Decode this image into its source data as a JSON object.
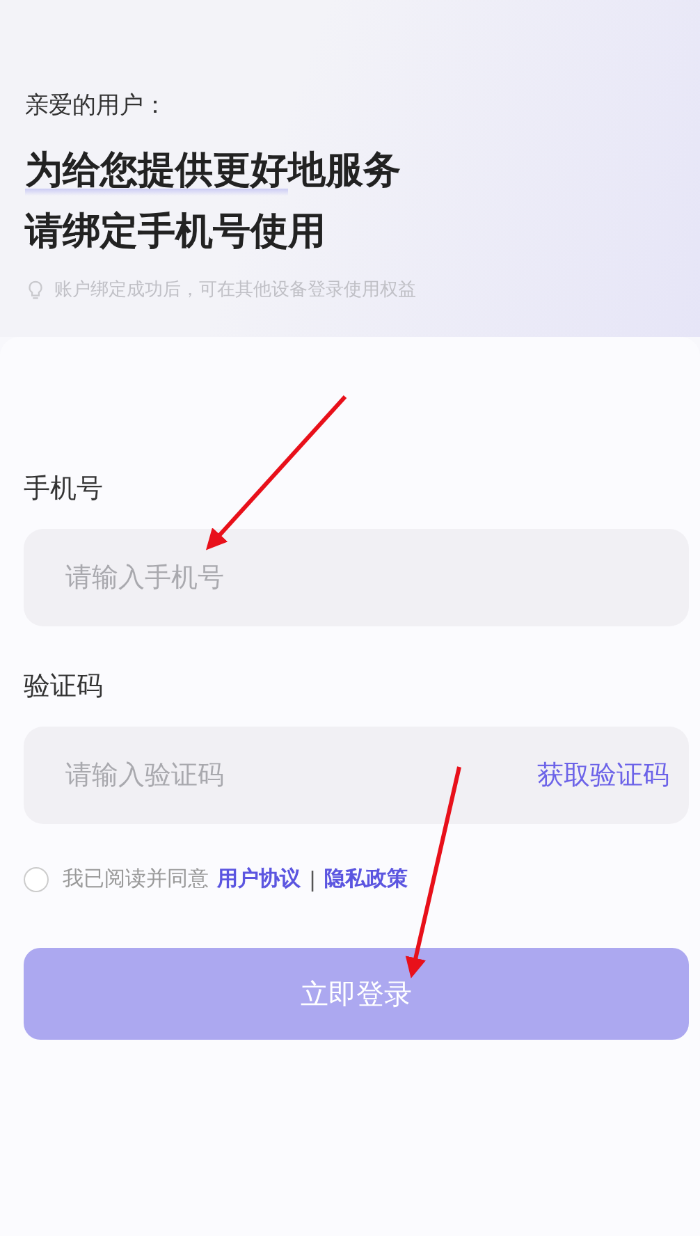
{
  "header": {
    "greeting": "亲爱的用户：",
    "headline": [
      "为给您提供更好地服务",
      "请绑定手机号使用"
    ],
    "hint": "账户绑定成功后，可在其他设备登录使用权益"
  },
  "form": {
    "phone": {
      "label": "手机号",
      "placeholder": "请输入手机号"
    },
    "code": {
      "label": "验证码",
      "placeholder": "请输入验证码",
      "action": "获取验证码"
    },
    "agreement": {
      "checked": false,
      "text": "我已阅读并同意",
      "links": [
        "用户协议",
        "隐私政策"
      ],
      "separator": "|"
    },
    "submit": {
      "label": "立即登录",
      "disabled": true
    }
  }
}
